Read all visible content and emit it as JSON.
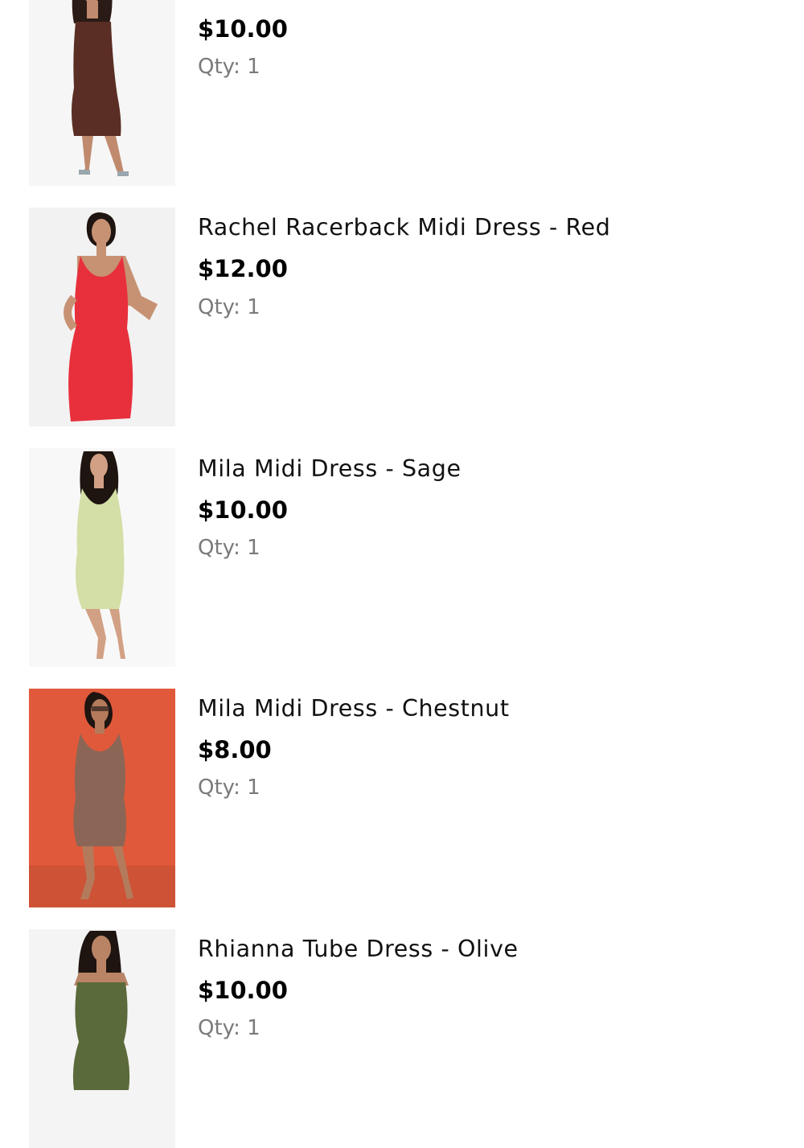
{
  "cart": {
    "items": [
      {
        "name": "",
        "price": "$10.00",
        "qty": "Qty: 1",
        "image": {
          "background": "#f6f6f6",
          "dress_color": "#5a2e24",
          "pose": "strapless"
        }
      },
      {
        "name": "Rachel Racerback Midi Dress - Red",
        "price": "$12.00",
        "qty": "Qty: 1",
        "image": {
          "background": "#f2f2f2",
          "dress_color": "#e8303c",
          "pose": "racerback"
        }
      },
      {
        "name": "Mila Midi Dress - Sage",
        "price": "$10.00",
        "qty": "Qty: 1",
        "image": {
          "background": "#f8f8f8",
          "dress_color": "#d3dfa6",
          "pose": "racerback"
        }
      },
      {
        "name": "Mila Midi Dress - Chestnut",
        "price": "$8.00",
        "qty": "Qty: 1",
        "image": {
          "background": "#e0593a",
          "dress_color": "#8b6656",
          "pose": "racerback"
        }
      },
      {
        "name": "Rhianna Tube Dress - Olive",
        "price": "$10.00",
        "qty": "Qty: 1",
        "image": {
          "background": "#f4f4f4",
          "dress_color": "#5b6a3a",
          "pose": "strapless"
        }
      }
    ]
  }
}
